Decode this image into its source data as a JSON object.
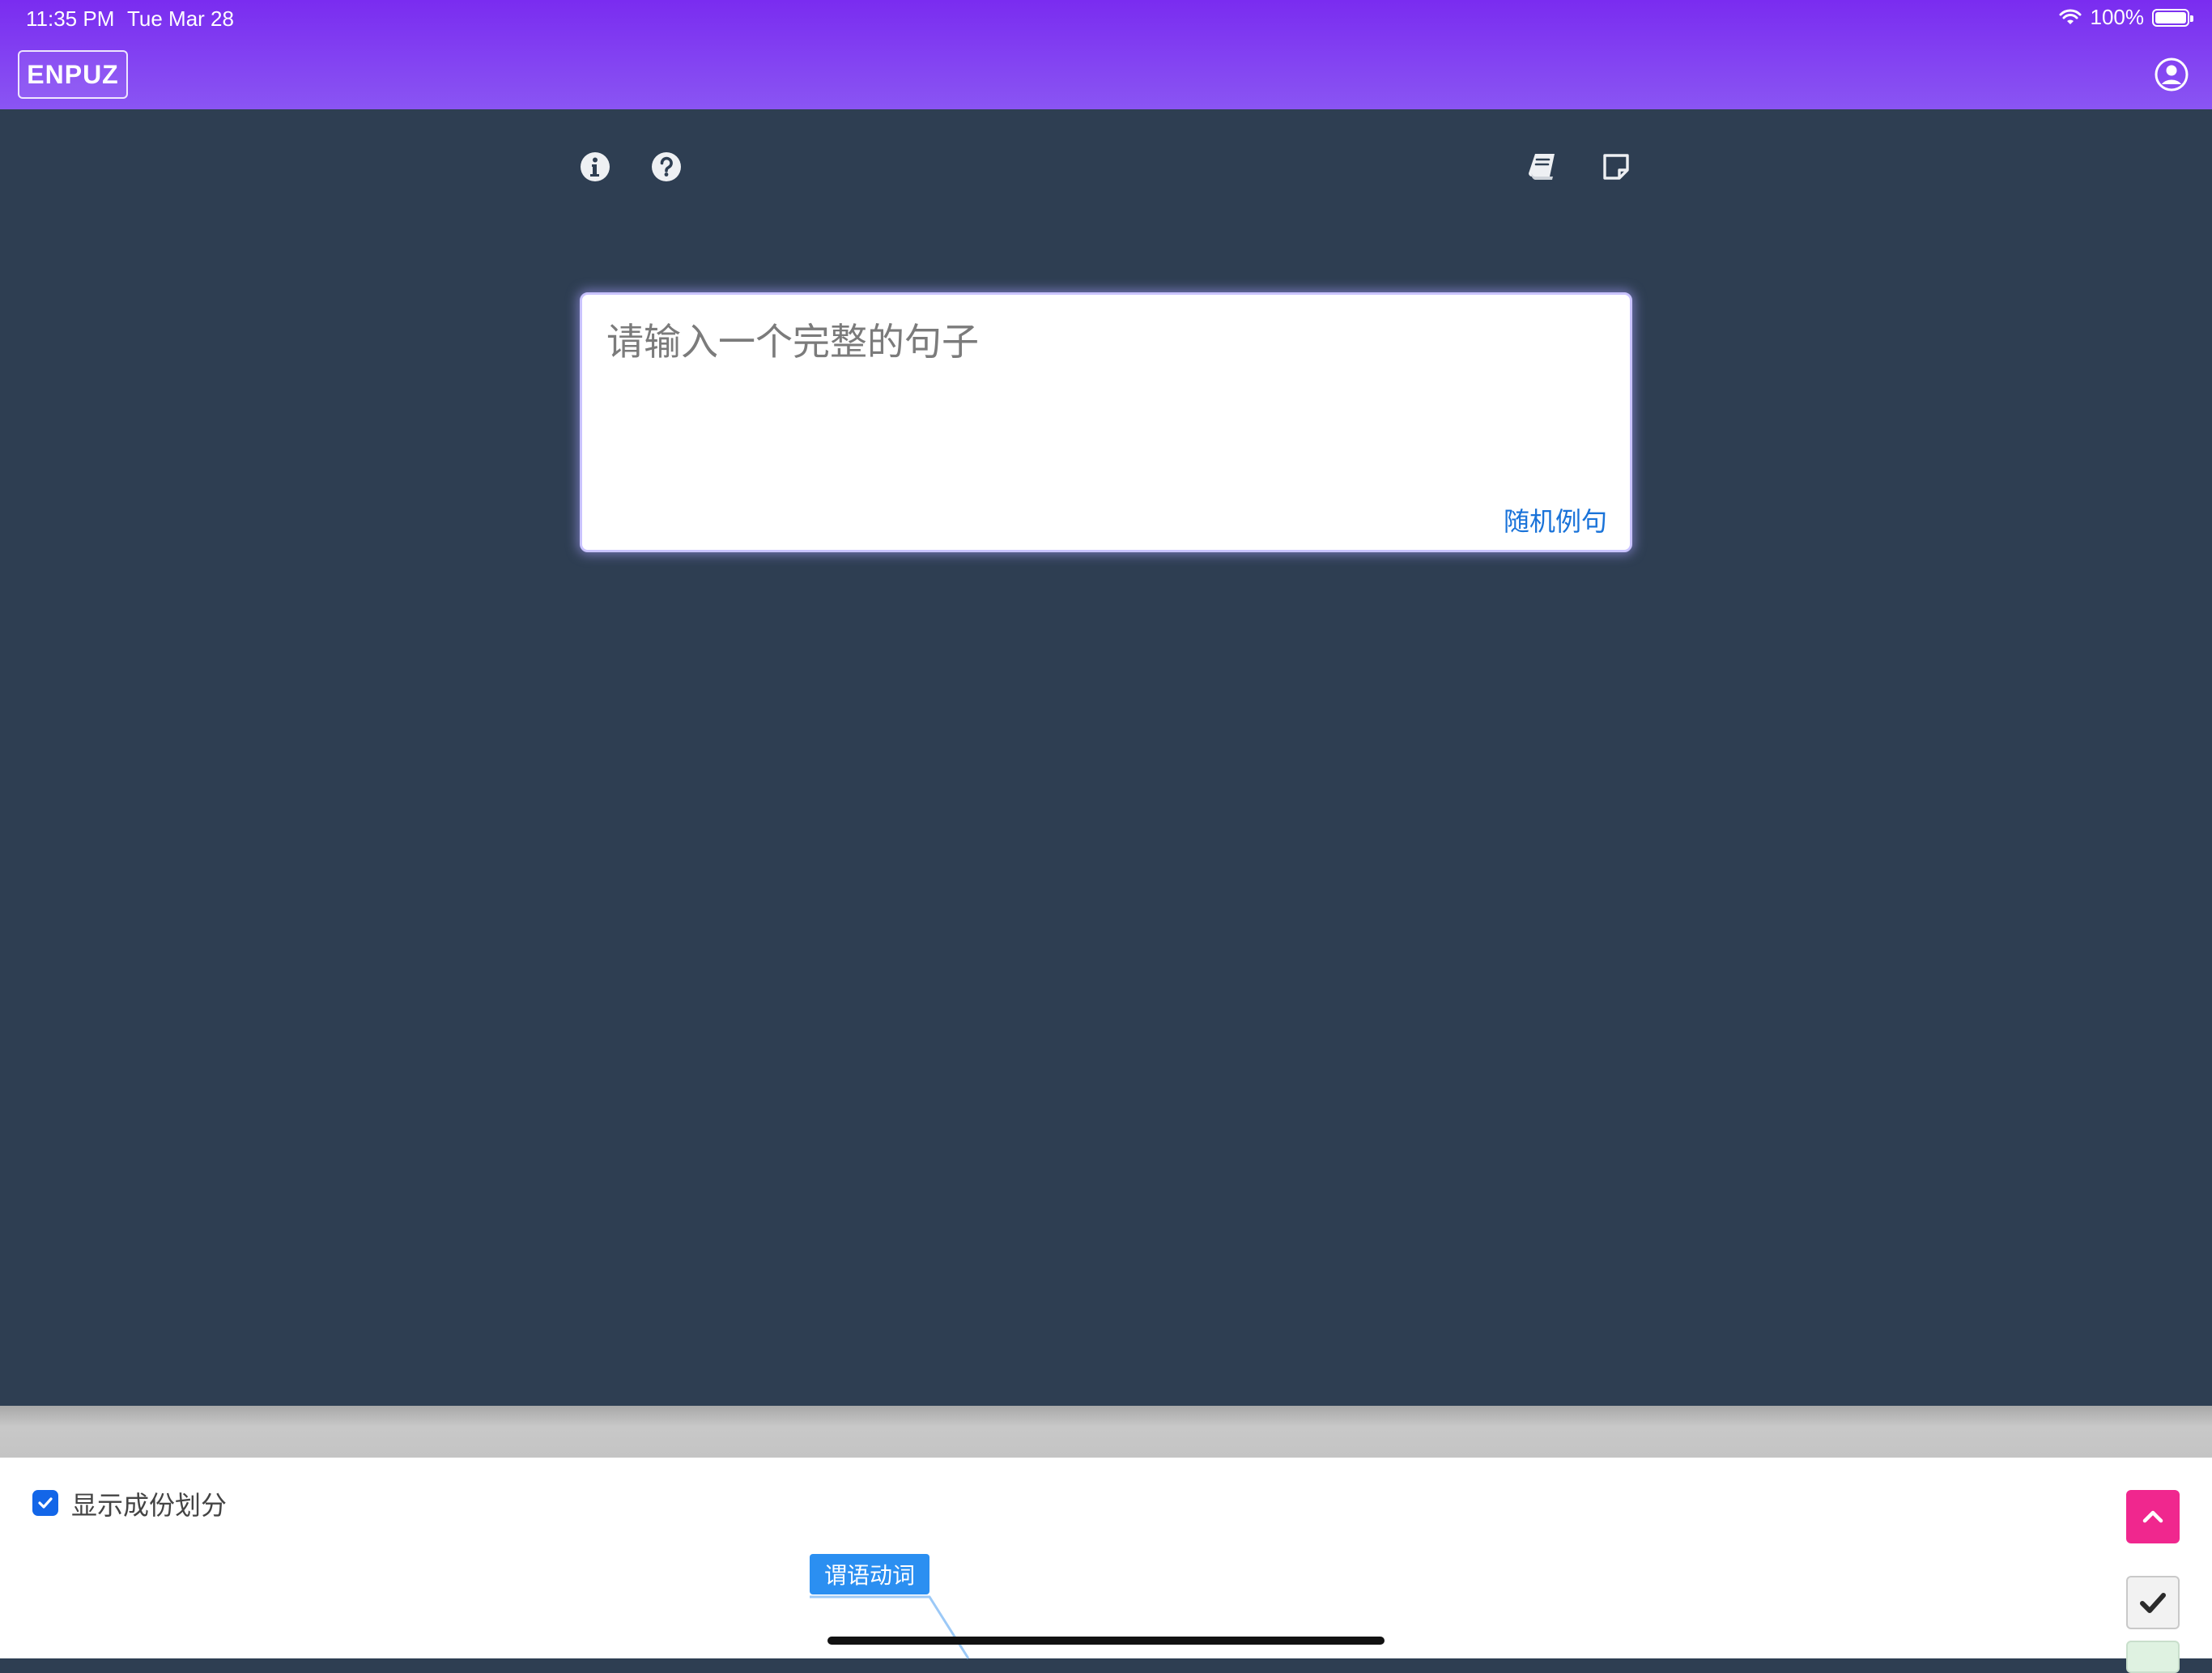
{
  "status_bar": {
    "time": "11:35 PM",
    "date": "Tue Mar 28",
    "battery_text": "100%",
    "battery_level": 1.0
  },
  "header": {
    "brand": "ENPUZ",
    "user_icon": "user-circle-icon",
    "background_colors": [
      "#7a2cf0",
      "#8a55f3"
    ]
  },
  "toolbar": {
    "left_icons": [
      "info-icon",
      "help-icon"
    ],
    "right_icons": [
      "book-icon",
      "note-icon"
    ]
  },
  "sentence_input": {
    "placeholder": "请输入一个完整的句子",
    "value": "",
    "random_example_label": "随机例句"
  },
  "bottom_panel": {
    "show_parts_label": "显示成份划分",
    "show_parts_checked": true,
    "tag_label": "谓语动词",
    "collapse_icon": "chevron-up-icon",
    "confirm_icon": "check-icon"
  },
  "colors": {
    "main_background": "#2e3e52",
    "accent_blue": "#1a73d9",
    "pink": "#f0278e",
    "tag_blue": "#2b8ff1"
  }
}
